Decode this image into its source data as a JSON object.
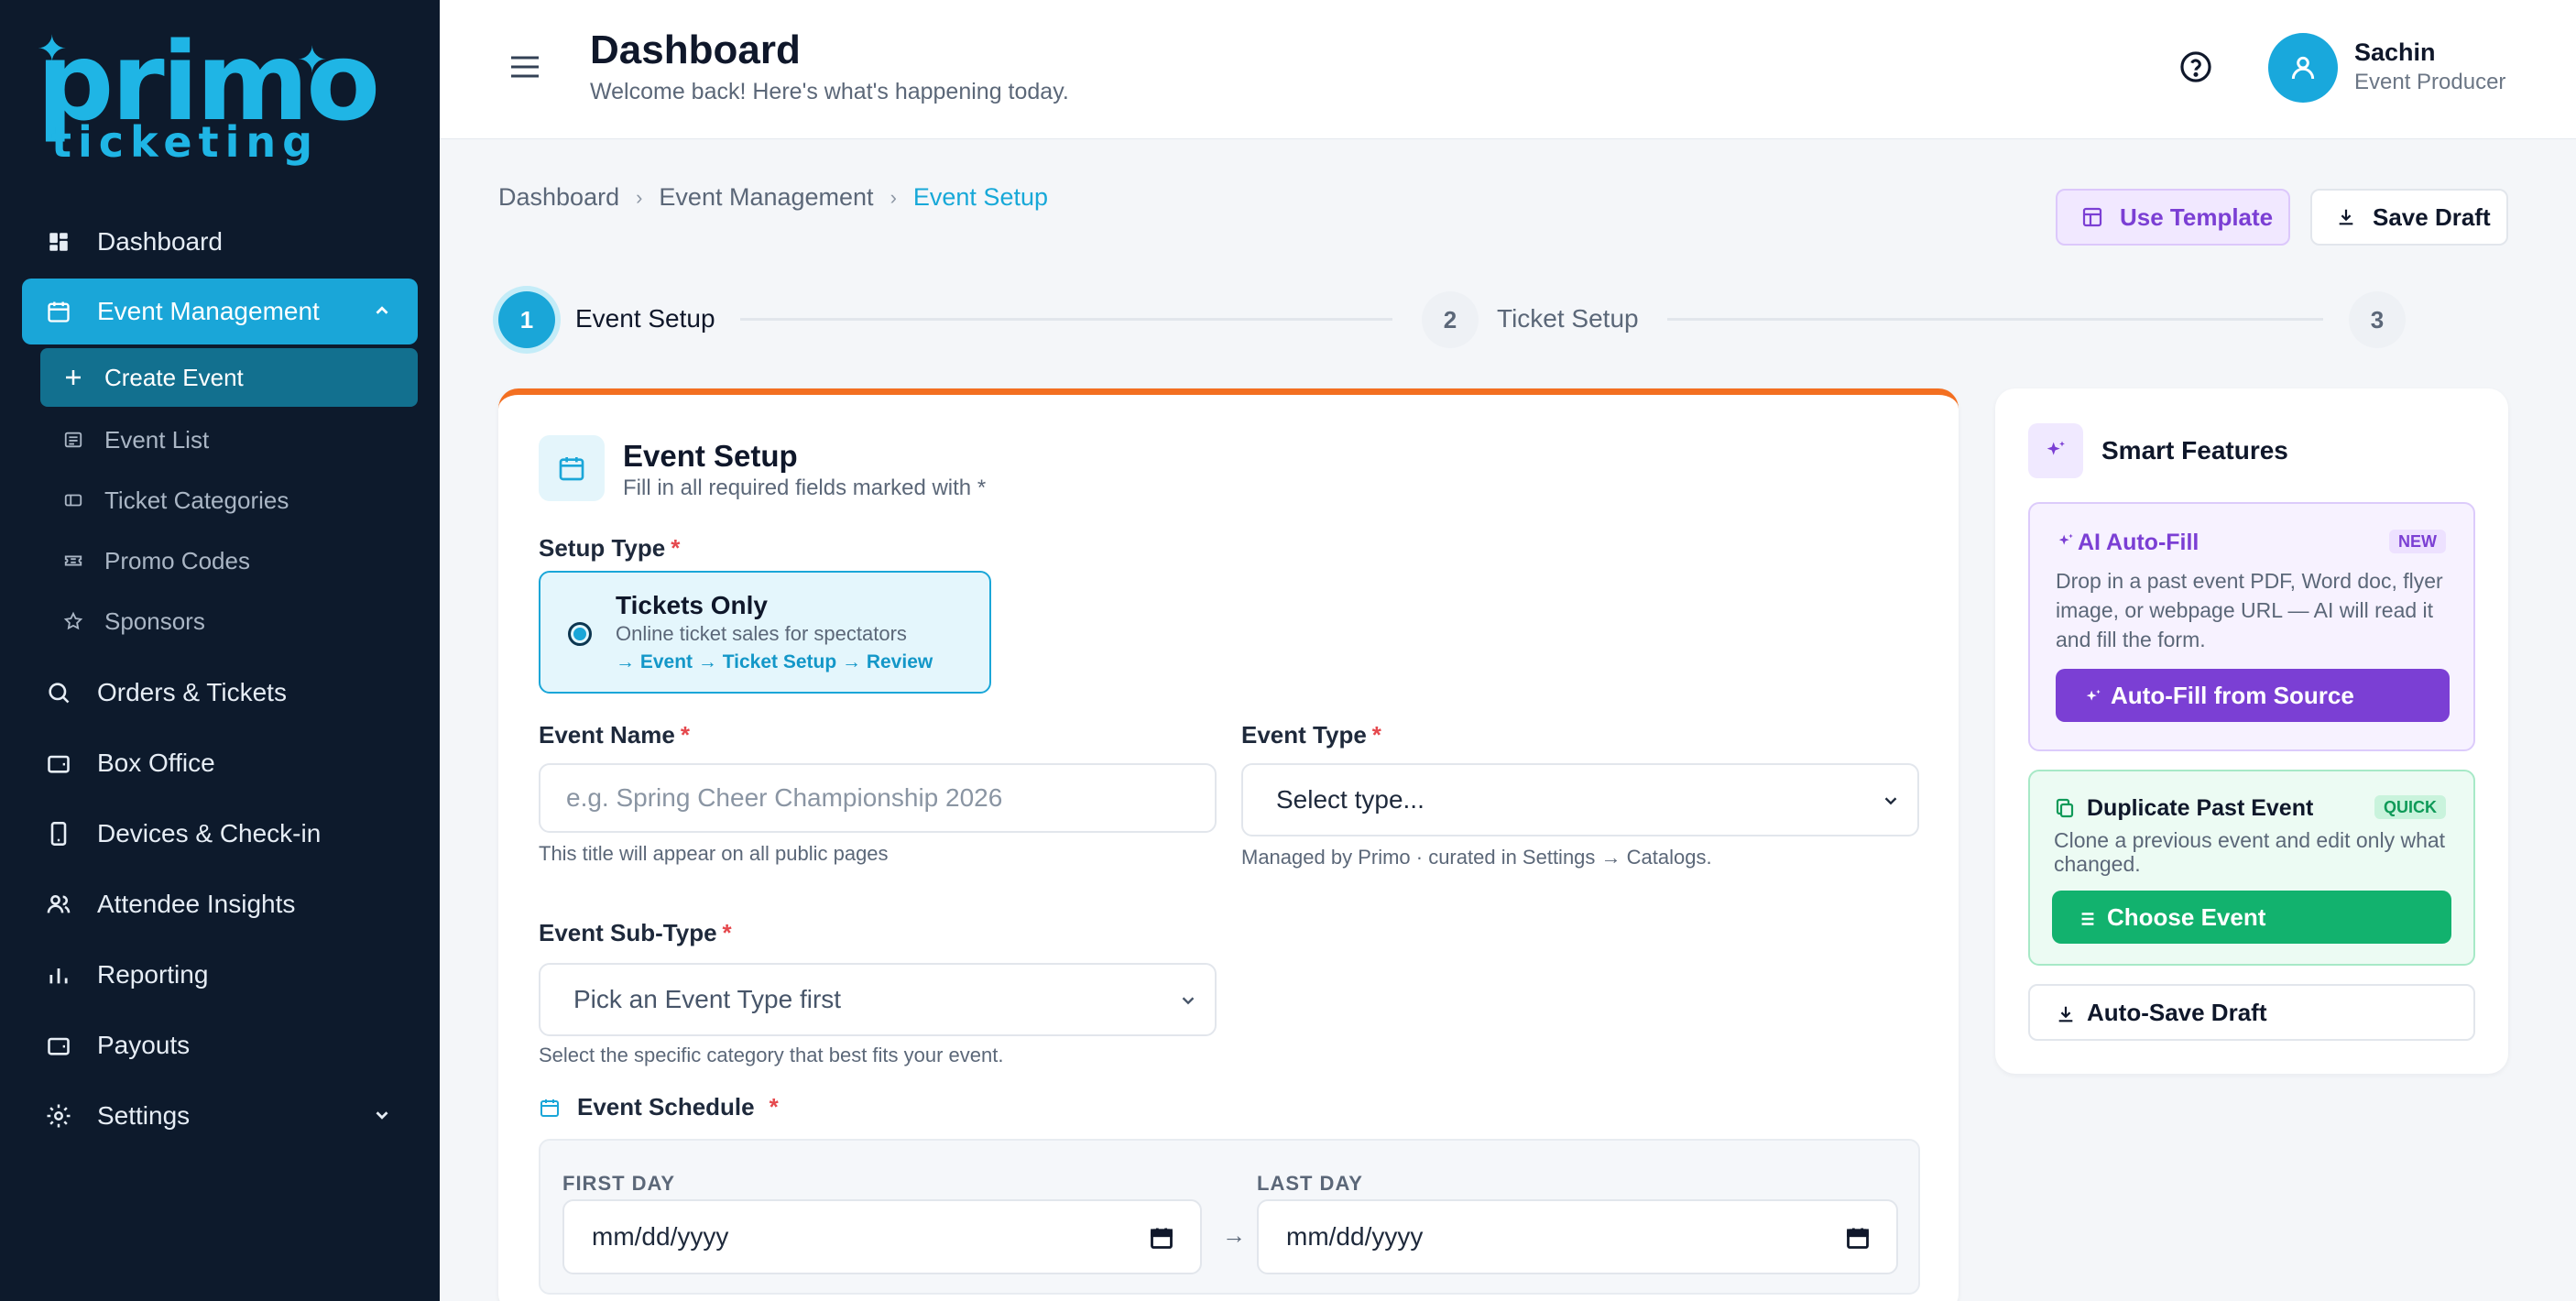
{
  "brand": {
    "logo_main": "primo",
    "logo_sub": "ticketing"
  },
  "sidebar": {
    "items": [
      {
        "label": "Dashboard",
        "icon": "dashboard-icon"
      },
      {
        "label": "Event Management",
        "icon": "calendar-icon",
        "active": true
      },
      {
        "label": "Orders & Tickets",
        "icon": "search-icon"
      },
      {
        "label": "Box Office",
        "icon": "wallet-icon"
      },
      {
        "label": "Devices & Check-in",
        "icon": "phone-icon"
      },
      {
        "label": "Attendee Insights",
        "icon": "users-icon"
      },
      {
        "label": "Reporting",
        "icon": "bar-chart-icon"
      },
      {
        "label": "Payouts",
        "icon": "wallet-icon"
      },
      {
        "label": "Settings",
        "icon": "gear-icon"
      }
    ],
    "sub_items": [
      {
        "label": "Create Event",
        "icon": "plus-icon",
        "active": true
      },
      {
        "label": "Event List",
        "icon": "list-icon"
      },
      {
        "label": "Ticket Categories",
        "icon": "tag-icon"
      },
      {
        "label": "Promo Codes",
        "icon": "ticket-icon"
      },
      {
        "label": "Sponsors",
        "icon": "star-icon"
      }
    ]
  },
  "header": {
    "title": "Dashboard",
    "subtitle": "Welcome back! Here's what's happening today.",
    "user_name": "Sachin",
    "user_role": "Event Producer"
  },
  "breadcrumb": [
    "Dashboard",
    "Event Management",
    "Event Setup"
  ],
  "breadcrumb_sep": "›",
  "actions": {
    "use_template": "Use Template",
    "save_draft": "Save Draft"
  },
  "stepper": {
    "steps": [
      {
        "number": "1",
        "label": "Event Setup"
      },
      {
        "number": "2",
        "label": "Ticket Setup"
      },
      {
        "number": "3",
        "label": ""
      }
    ]
  },
  "form": {
    "title": "Event Setup",
    "subtitle": "Fill in all required fields marked with *",
    "required_mark": "*",
    "setup_type": {
      "label": "Setup Type",
      "option_title": "Tickets Only",
      "option_desc": "Online ticket sales for spectators",
      "option_flow": "→ Event → Ticket Setup → Review"
    },
    "event_name": {
      "label": "Event Name",
      "placeholder": "e.g. Spring Cheer Championship 2026",
      "hint": "This title will appear on all public pages"
    },
    "event_type": {
      "label": "Event Type",
      "value": "Select type...",
      "hint": "Managed by Primo · curated in Settings → Catalogs."
    },
    "event_subtype": {
      "label": "Event Sub-Type",
      "value": "Pick an Event Type first",
      "hint": "Select the specific category that best fits your event."
    },
    "schedule": {
      "label": "Event Schedule",
      "first_day_label": "FIRST DAY",
      "first_day_value": "mm/dd/yyyy",
      "arrow": "→",
      "last_day_label": "LAST DAY",
      "last_day_value": "mm/dd/yyyy"
    }
  },
  "smart": {
    "title": "Smart Features",
    "ai_title": "AI Auto-Fill",
    "ai_badge": "NEW",
    "ai_desc": "Drop in a past event PDF, Word doc, flyer image, or webpage URL — AI will read it and fill the form.",
    "ai_button": "Auto-Fill from Source",
    "dup_title": "Duplicate Past Event",
    "dup_badge": "QUICK",
    "dup_desc": "Clone a previous event and edit only what changed.",
    "dup_button": "Choose Event",
    "autosave": "Auto-Save Draft"
  },
  "colors": {
    "sidebar_bg": "#0d1a2c",
    "accent": "#1aa6d8",
    "card_top_border": "#f36f21",
    "purple": "#7b3fd4",
    "green": "#12b26e"
  }
}
